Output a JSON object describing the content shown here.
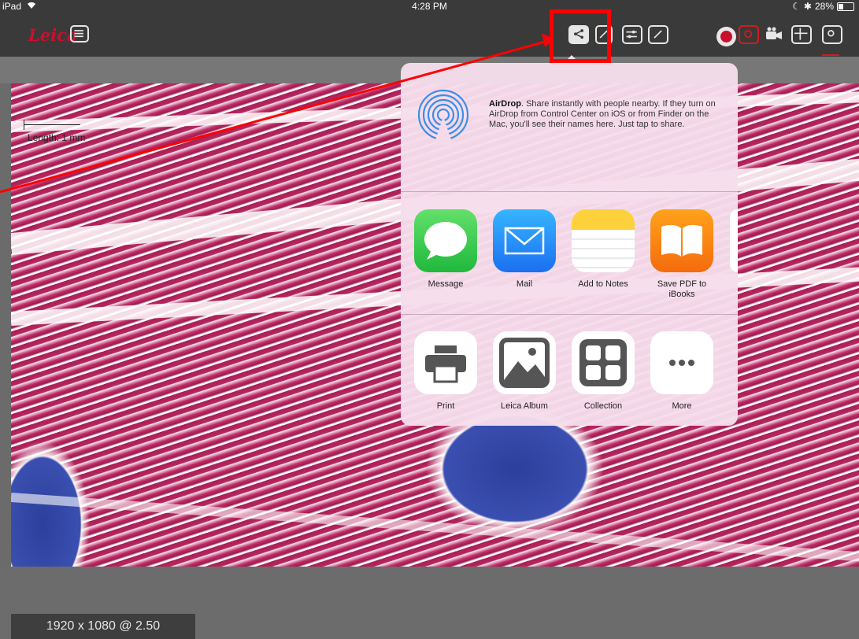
{
  "status_bar": {
    "device": "iPad",
    "time": "4:28 PM",
    "battery": "28%"
  },
  "toolbar": {
    "logo": "Leica",
    "icons": [
      "menu-icon",
      "share-icon",
      "annotate-icon",
      "adjust-icon",
      "edit-icon",
      "record-icon",
      "camera-icon",
      "video-icon",
      "grid-icon",
      "snapshot-icon"
    ]
  },
  "image": {
    "scale_label": "Length: 1 mm"
  },
  "footer": {
    "resolution": "1920 x 1080 @ 2.50"
  },
  "share_sheet": {
    "airdrop": {
      "title": "AirDrop",
      "description": ". Share instantly with people nearby. If they turn on AirDrop from Control Center on iOS or from Finder on the Mac, you'll see their names here. Just tap to share."
    },
    "apps": [
      {
        "label": "Message"
      },
      {
        "label": "Mail"
      },
      {
        "label": "Add to Notes"
      },
      {
        "label": "Save PDF to iBooks"
      }
    ],
    "actions": [
      {
        "label": "Print"
      },
      {
        "label": "Leica Album"
      },
      {
        "label": "Collection"
      },
      {
        "label": "More"
      }
    ]
  },
  "colors": {
    "highlight": "#ff0000",
    "brand": "#c8102e",
    "toolbar_bg": "#3a3a3a",
    "sheet_bg": "#f6deec"
  }
}
